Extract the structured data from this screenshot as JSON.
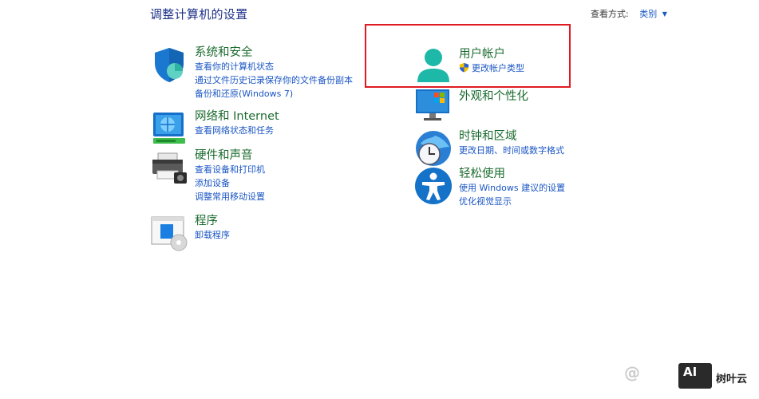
{
  "page": {
    "title": "调整计算机的设置",
    "view_by_label": "查看方式:",
    "view_by_value": "类别"
  },
  "left": [
    {
      "heading": "系统和安全",
      "links": [
        "查看你的计算机状态",
        "通过文件历史记录保存你的文件备份副本",
        "备份和还原(Windows 7)"
      ]
    },
    {
      "heading": "网络和 Internet",
      "links": [
        "查看网络状态和任务"
      ]
    },
    {
      "heading": "硬件和声音",
      "links": [
        "查看设备和打印机",
        "添加设备",
        "调整常用移动设置"
      ]
    },
    {
      "heading": "程序",
      "links": [
        "卸载程序"
      ]
    }
  ],
  "right": [
    {
      "heading": "用户帐户",
      "links": [
        "更改帐户类型"
      ]
    },
    {
      "heading": "外观和个性化",
      "links": []
    },
    {
      "heading": "时钟和区域",
      "links": [
        "更改日期、时间或数字格式"
      ]
    },
    {
      "heading": "轻松使用",
      "links": [
        "使用 Windows 建议的设置",
        "优化视觉显示"
      ]
    }
  ],
  "watermark": {
    "handle": "@",
    "badge": "AI",
    "site": "树叶云"
  },
  "colors": {
    "heading": "#1a6b2e",
    "link": "#1a56c4",
    "title": "#1e3287",
    "highlight": "#e01a22"
  }
}
